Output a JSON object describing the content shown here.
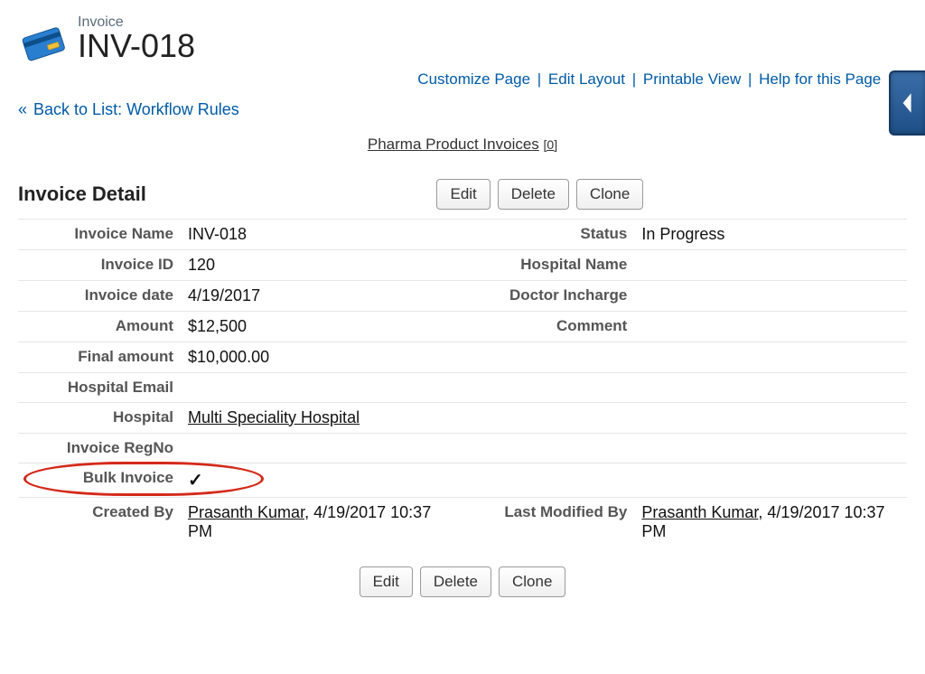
{
  "header": {
    "object_label": "Invoice",
    "record_name": "INV-018"
  },
  "top_links": {
    "customize": "Customize Page",
    "edit_layout": "Edit Layout",
    "printable": "Printable View",
    "help": "Help for this Page"
  },
  "back_link": "Back to List: Workflow Rules",
  "related_list": {
    "label": "Pharma Product Invoices",
    "count": "[0]"
  },
  "section_title": "Invoice Detail",
  "buttons": {
    "edit": "Edit",
    "delete": "Delete",
    "clone": "Clone"
  },
  "labels": {
    "invoice_name": "Invoice Name",
    "status": "Status",
    "invoice_id": "Invoice ID",
    "hospital_name": "Hospital Name",
    "invoice_date": "Invoice date",
    "doctor_incharge": "Doctor Incharge",
    "amount": "Amount",
    "comment": "Comment",
    "final_amount": "Final amount",
    "hospital_email": "Hospital Email",
    "hospital": "Hospital",
    "invoice_regno": "Invoice RegNo",
    "bulk_invoice": "Bulk Invoice",
    "created_by": "Created By",
    "last_modified_by": "Last Modified By"
  },
  "values": {
    "invoice_name": "INV-018",
    "status": "In Progress",
    "invoice_id": "120",
    "hospital_name": "",
    "invoice_date": "4/19/2017",
    "doctor_incharge": "",
    "amount": "$12,500",
    "comment": "",
    "final_amount": "$10,000.00",
    "hospital_email": "",
    "hospital": "Multi Speciality Hospital",
    "invoice_regno": "",
    "bulk_invoice": true,
    "created_by_user": "Prasanth Kumar",
    "created_by_date": ", 4/19/2017 10:37 PM",
    "last_modified_by_user": "Prasanth Kumar",
    "last_modified_by_date": ", 4/19/2017 10:37 PM"
  }
}
